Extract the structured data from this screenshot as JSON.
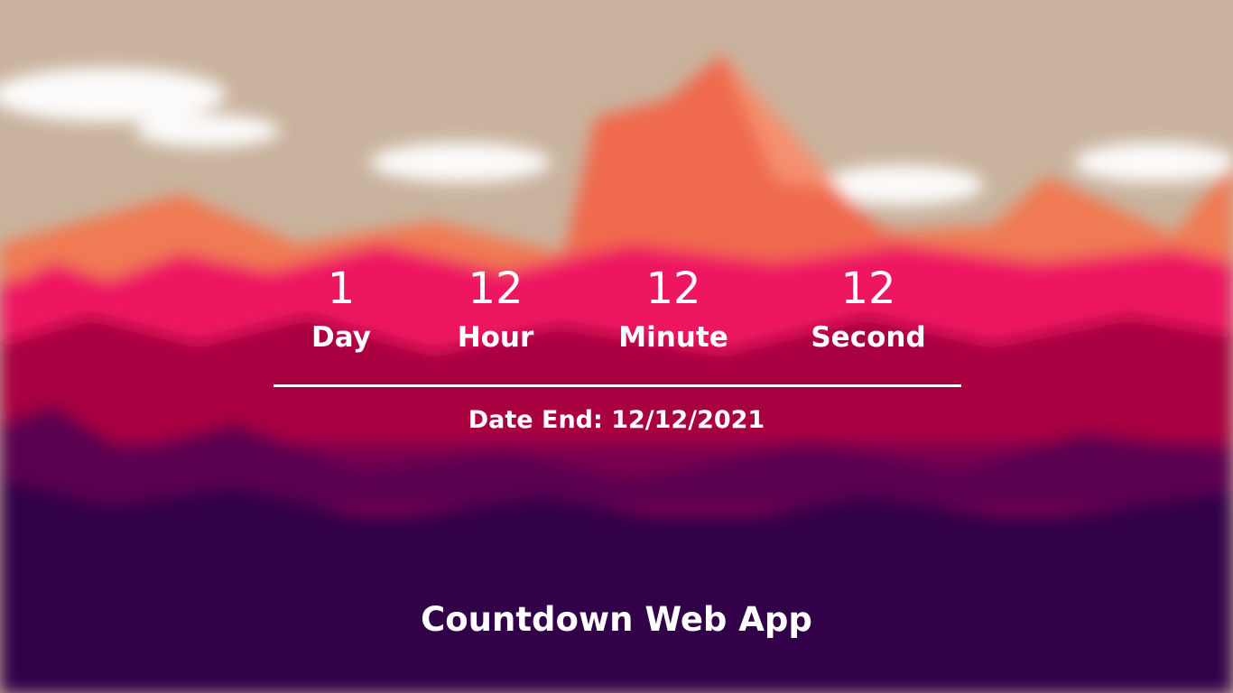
{
  "countdown": [
    {
      "value": "1",
      "label": "Day"
    },
    {
      "value": "12",
      "label": "Hour"
    },
    {
      "value": "12",
      "label": "Minute"
    },
    {
      "value": "12",
      "label": "Second"
    }
  ],
  "date_end": "Date End: 12/12/2021",
  "app_title": "Countdown Web App",
  "colors": {
    "sky": "#c9b39e",
    "mountain": "#f06a4e",
    "pink": "#ee1560",
    "crimson": "#a8003f",
    "purple": "#33004a"
  }
}
